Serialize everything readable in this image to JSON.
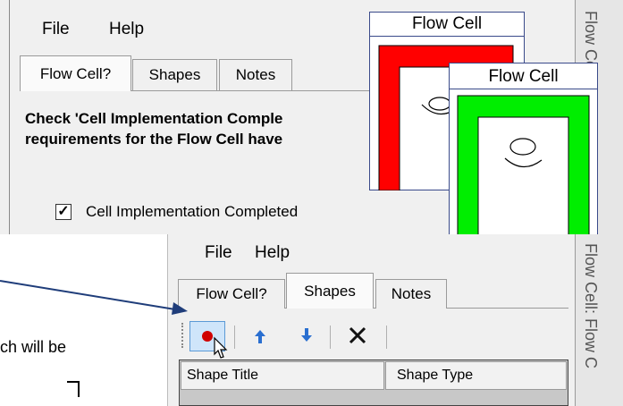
{
  "window_top": {
    "menu": [
      "File",
      "Help"
    ],
    "tabs": [
      "Flow Cell?",
      "Shapes",
      "Notes"
    ],
    "active_tab": "Flow Cell?",
    "instruction_line1": "Check 'Cell Implementation Comple",
    "instruction_line2": "requirements for the Flow Cell have",
    "checkbox_label": "Cell Implementation Completed",
    "checkbox_checked": true,
    "sidebar_text": "Flow Cell: Flow Cell"
  },
  "window_bottom": {
    "menu": [
      "File",
      "Help"
    ],
    "tabs": [
      "Flow Cell?",
      "Shapes",
      "Notes"
    ],
    "active_tab": "Shapes",
    "toolbar": [
      "record-button",
      "move-up-button",
      "move-down-button",
      "delete-button"
    ],
    "columns": [
      "Shape Title",
      "Shape Type"
    ],
    "sidebar_text": "Flow Cell: Flow C"
  },
  "flow_cell_red": {
    "title": "Flow Cell",
    "color": "#ff0000"
  },
  "flow_cell_green": {
    "title": "Flow Cell",
    "color": "#00ee00"
  },
  "callout_text": "ch will be",
  "colors": {
    "arrow": "#1f3d7a",
    "record": "#d00000",
    "toolbar_arrows": "#2a6fd0"
  }
}
